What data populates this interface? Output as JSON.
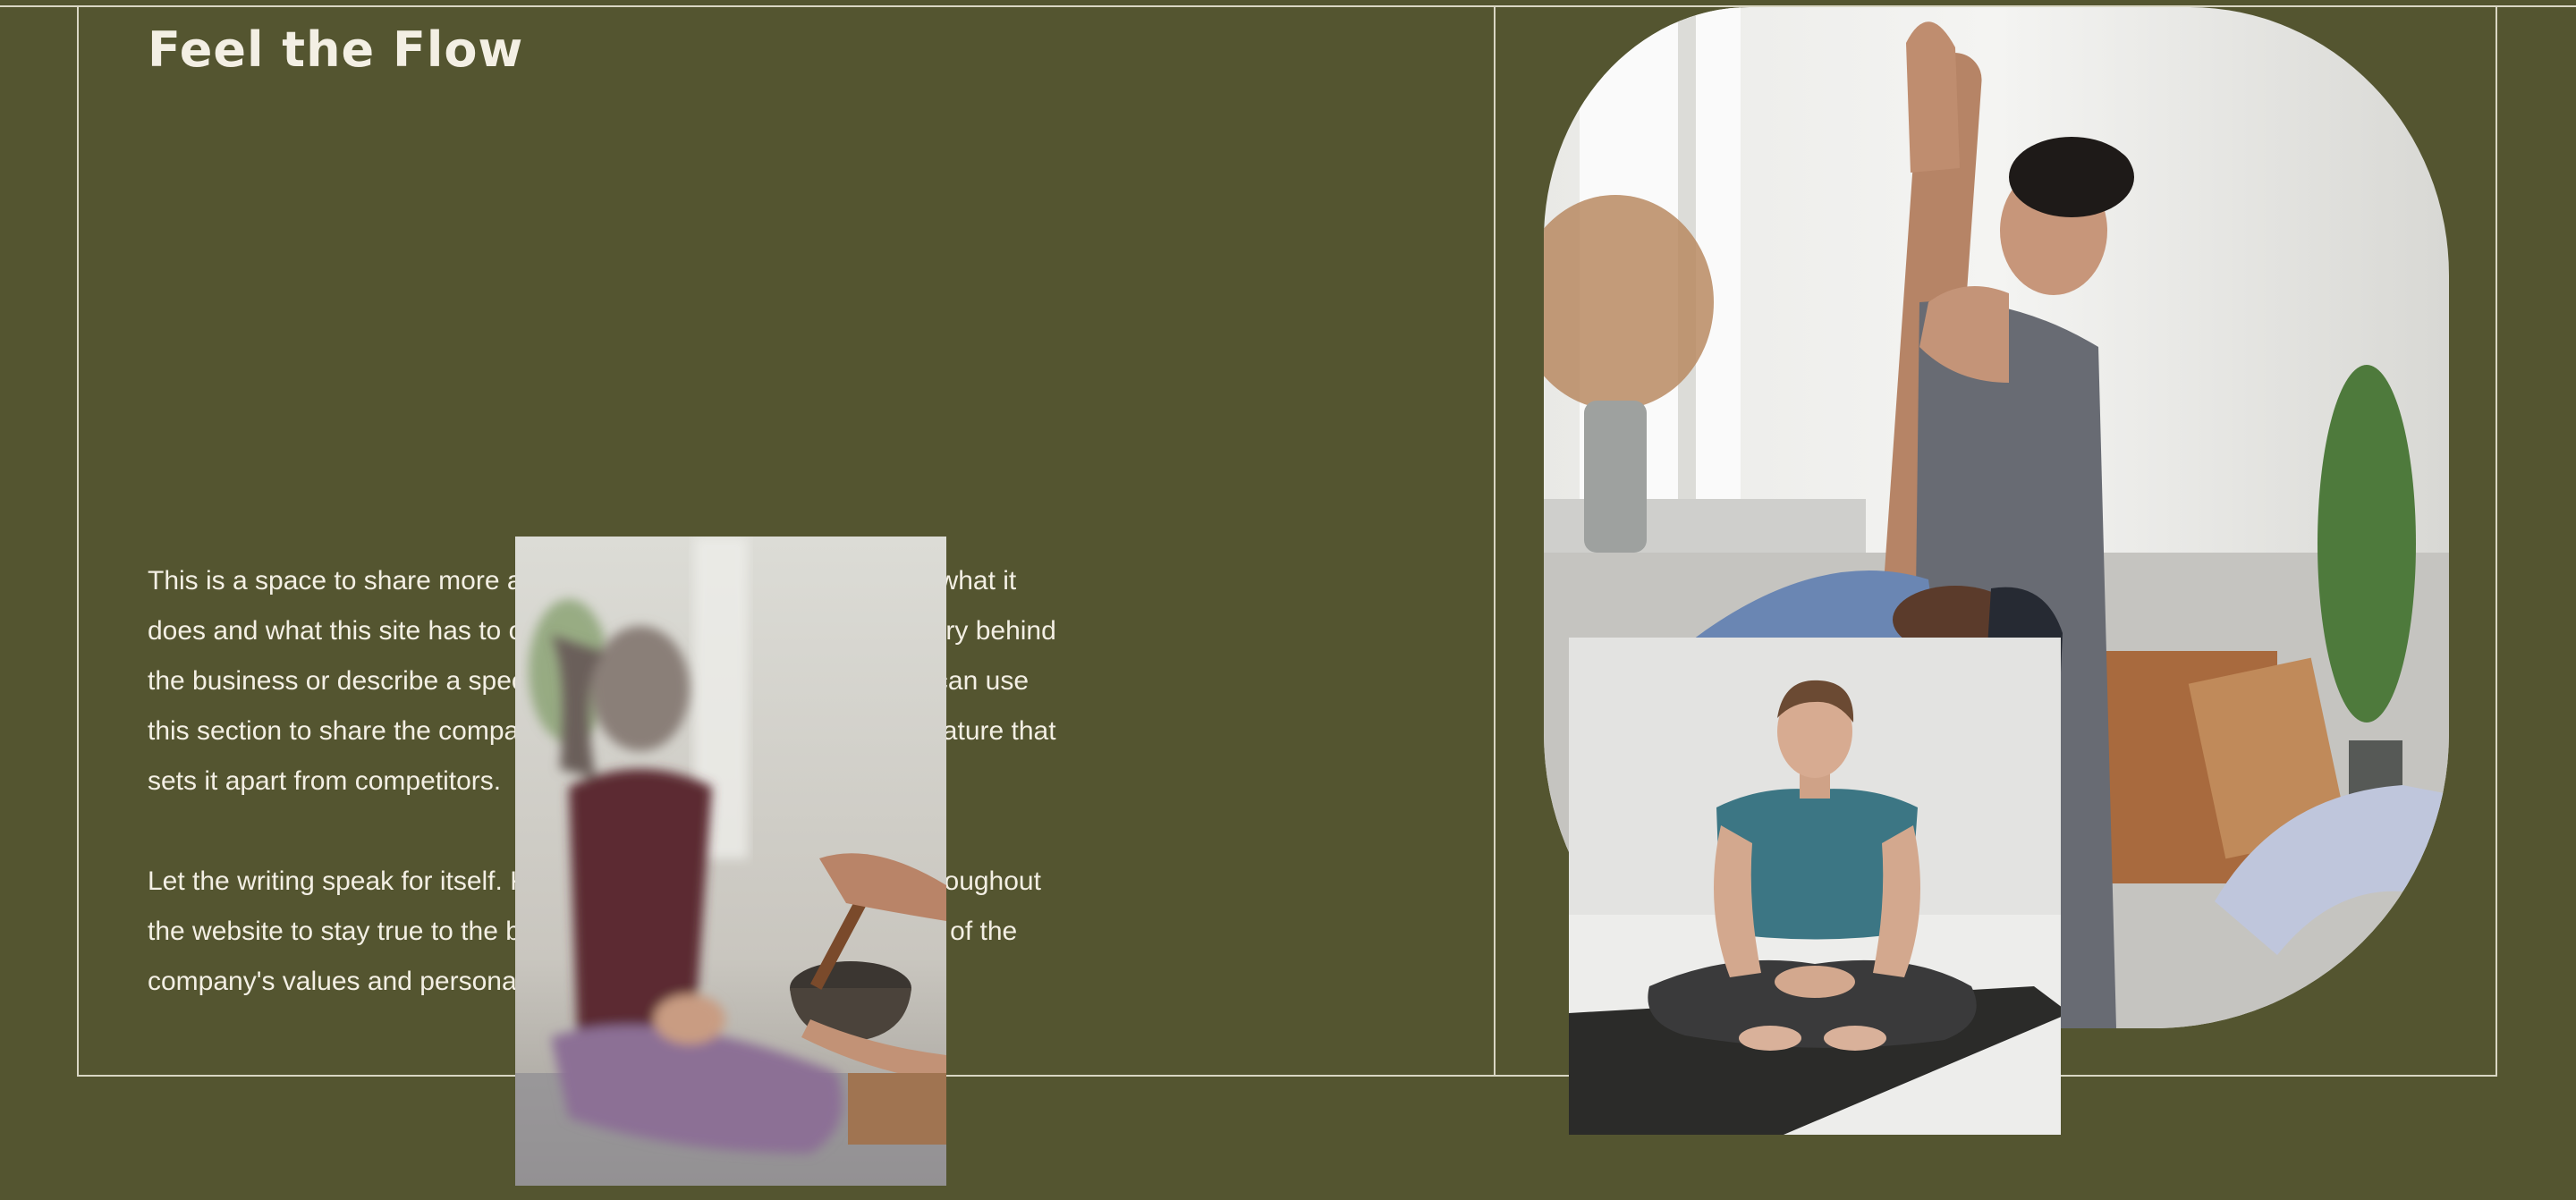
{
  "section": {
    "title": "Feel the Flow",
    "paragraph_1": "This is a space to share more about the business: who's behind it, what it does and what this site has to offer. It's an opportunity to tell the story behind the business or describe a special service or product it offers. You can use this section to share the company history or highlight a particular feature that sets it apart from competitors.",
    "paragraph_2": "Let the writing speak for itself. Keep a consistent tone and voice throughout the website to stay true to the brand image and give visitors a taste of the company's values and personality."
  },
  "images": {
    "singing_bowl": "singing-bowl-photo",
    "assisted_stretch": "assisted-stretch-photo",
    "seated_meditation": "seated-meditation-photo"
  },
  "colors": {
    "background": "#545530",
    "text": "#f3efe4",
    "lines": "#d9d6c4"
  }
}
